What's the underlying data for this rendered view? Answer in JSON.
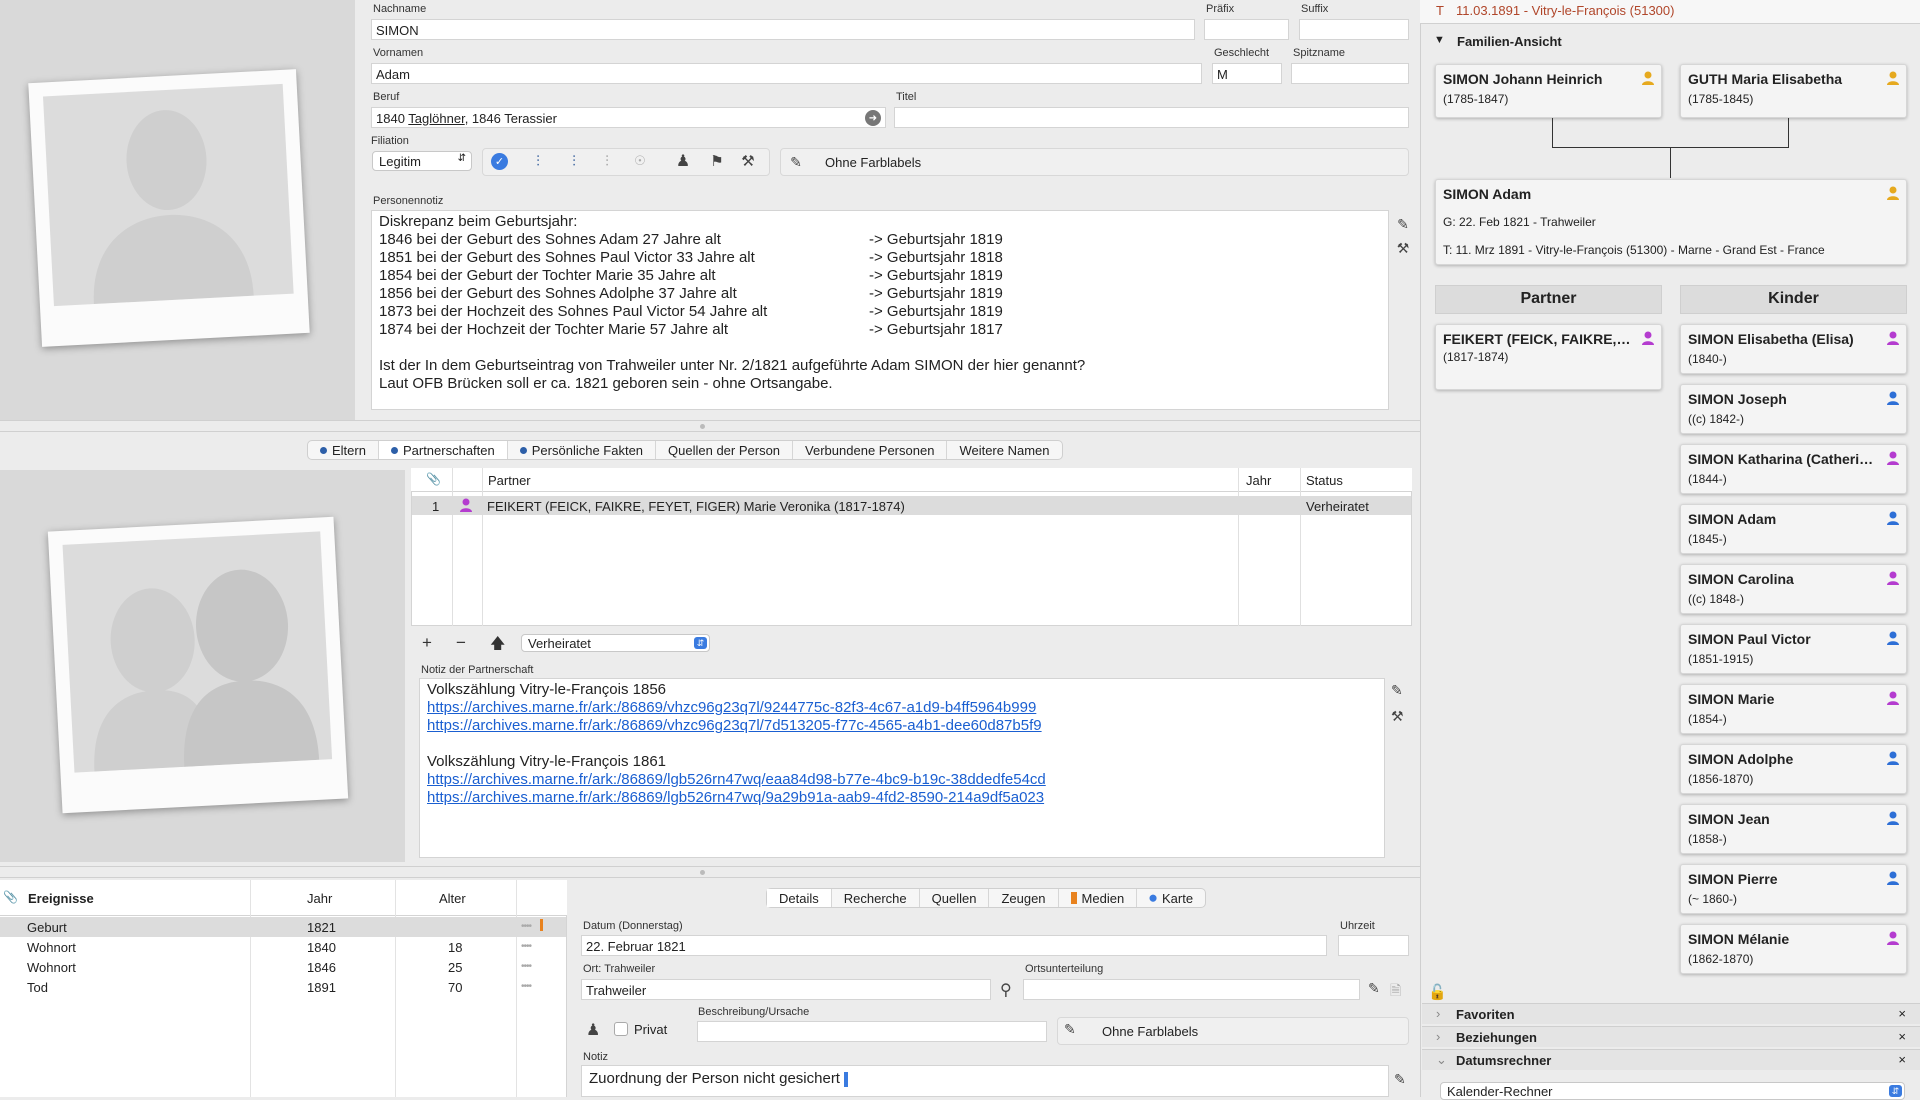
{
  "person": {
    "labels": {
      "nachname": "Nachname",
      "praefix": "Präfix",
      "suffix": "Suffix",
      "vornamen": "Vornamen",
      "geschlecht": "Geschlecht",
      "spitzname": "Spitzname",
      "beruf": "Beruf",
      "titel": "Titel",
      "filiation": "Filiation",
      "personennotiz": "Personennotiz"
    },
    "nachname": "SIMON",
    "praefix": "",
    "suffix": "",
    "vornamen": "Adam",
    "geschlecht": "M",
    "spitzname": "",
    "beruf_pre": "1840 ",
    "beruf_link": "Taglöhner",
    "beruf_post": ", 1846 Terassier",
    "titel": "",
    "filiation": "Legitim",
    "farblabel": "Ohne Farblabels",
    "note": [
      "Diskrepanz beim Geburtsjahr:",
      "1846 bei der Geburt des Sohnes Adam 27 Jahre alt",
      "1851 bei der Geburt des Sohnes Paul Victor 33 Jahre alt",
      "1854 bei der Geburt der Tochter Marie 35 Jahre alt",
      "1856 bei der Geburt des Sohnes Adolphe 37 Jahre alt",
      "1873 bei der Hochzeit des Sohnes Paul Victor 54 Jahre alt",
      "1874 bei der Hochzeit der Tochter Marie 57 Jahre alt",
      "",
      "Ist der In dem Geburtseintrag von Trahweiler unter Nr. 2/1821 aufgeführte Adam SIMON der hier genannt?",
      "Laut OFB Brücken soll er ca. 1821 geboren sein - ohne Ortsangabe."
    ],
    "note_right": [
      "",
      "-> Geburtsjahr 1819",
      "-> Geburtsjahr 1818",
      "-> Geburtsjahr 1819",
      "-> Geburtsjahr 1819",
      "-> Geburtsjahr 1819",
      "-> Geburtsjahr 1817",
      "",
      "",
      ""
    ]
  },
  "tabs": [
    {
      "label": "Eltern",
      "dot": true
    },
    {
      "label": "Partnerschaften",
      "dot": true,
      "selected": true
    },
    {
      "label": "Persönliche Fakten",
      "dot": true
    },
    {
      "label": "Quellen der Person",
      "dot": false
    },
    {
      "label": "Verbundene Personen",
      "dot": false
    },
    {
      "label": "Weitere Namen",
      "dot": false
    }
  ],
  "partners": {
    "headers": {
      "partner": "Partner",
      "jahr": "Jahr",
      "status": "Status"
    },
    "rows": [
      {
        "num": "1",
        "name": "FEIKERT (FEICK, FAIKRE, FEYET, FIGER) Marie Veronika (1817-1874)",
        "jahr": "",
        "status": "Verheiratet"
      }
    ],
    "status_select": "Verheiratet",
    "note_label": "Notiz der Partnerschaft",
    "note": [
      {
        "text": "Volkszählung Vitry-le-François 1856",
        "link": false
      },
      {
        "text": "https://archives.marne.fr/ark:/86869/vhzc96g23q7l/9244775c-82f3-4c67-a1d9-b4ff5964b999",
        "link": true
      },
      {
        "text": "https://archives.marne.fr/ark:/86869/vhzc96g23q7l/7d513205-f77c-4565-a4b1-dee60d87b5f9",
        "link": true
      },
      {
        "text": "",
        "link": false
      },
      {
        "text": "Volkszählung Vitry-le-François 1861",
        "link": false
      },
      {
        "text": "https://archives.marne.fr/ark:/86869/lgb526rn47wq/eaa84d98-b77e-4bc9-b19c-38ddedfe54cd",
        "link": true
      },
      {
        "text": "https://archives.marne.fr/ark:/86869/lgb526rn47wq/9a29b91a-aab9-4fd2-8590-214a9df5a023",
        "link": true
      }
    ]
  },
  "events": {
    "headers": {
      "ereignisse": "Ereignisse",
      "jahr": "Jahr",
      "alter": "Alter"
    },
    "rows": [
      {
        "name": "Geburt",
        "jahr": "1821",
        "alter": "",
        "selected": true
      },
      {
        "name": "Wohnort",
        "jahr": "1840",
        "alter": "18"
      },
      {
        "name": "Wohnort",
        "jahr": "1846",
        "alter": "25"
      },
      {
        "name": "Tod",
        "jahr": "1891",
        "alter": "70"
      }
    ]
  },
  "details": {
    "tabs": [
      "Details",
      "Recherche",
      "Quellen",
      "Zeugen",
      "Medien",
      "Karte"
    ],
    "datum_label": "Datum (Donnerstag)",
    "datum": "22. Februar 1821",
    "uhrzeit_label": "Uhrzeit",
    "uhrzeit": "",
    "ort_label": "Ort: Trahweiler",
    "ort": "Trahweiler",
    "ortsunterteilung_label": "Ortsunterteilung",
    "ortsunterteilung": "",
    "privat_label": "Privat",
    "beschreibung_label": "Beschreibung/Ursache",
    "beschreibung": "",
    "farblabel": "Ohne Farblabels",
    "notiz_label": "Notiz",
    "notiz": "Zuordnung der Person nicht gesichert "
  },
  "family": {
    "top_line_prefix": "T",
    "top_line": "11.03.1891 - Vitry-le-François (51300)",
    "header": "Familien-Ansicht",
    "father": {
      "name": "SIMON Johann Heinrich",
      "dates": "(1785-1847)"
    },
    "mother": {
      "name": "GUTH Maria Elisabetha",
      "dates": "(1785-1845)"
    },
    "self": {
      "name": "SIMON Adam",
      "birth": "G: 22. Feb 1821 - Trahweiler",
      "death": "T: 11. Mrz 1891 - Vitry-le-François (51300) - Marne - Grand Est - France"
    },
    "partner_header": "Partner",
    "kinder_header": "Kinder",
    "partner": {
      "name": "FEIKERT (FEICK, FAIKRE, FEYET, FIGER) Marie Veronika",
      "dates": "(1817-1874)"
    },
    "children": [
      {
        "name": "SIMON Elisabetha (Elisa)",
        "dates": "(1840-)",
        "sex": "f"
      },
      {
        "name": "SIMON Joseph",
        "dates": "((c) 1842-)",
        "sex": "m"
      },
      {
        "name": "SIMON Katharina (Catherine)",
        "dates": "(1844-)",
        "sex": "f"
      },
      {
        "name": "SIMON Adam",
        "dates": "(1845-)",
        "sex": "m"
      },
      {
        "name": "SIMON Carolina",
        "dates": "((c) 1848-)",
        "sex": "f"
      },
      {
        "name": "SIMON Paul Victor",
        "dates": "(1851-1915)",
        "sex": "m"
      },
      {
        "name": "SIMON Marie",
        "dates": "(1854-)",
        "sex": "f"
      },
      {
        "name": "SIMON Adolphe",
        "dates": "(1856-1870)",
        "sex": "m"
      },
      {
        "name": "SIMON Jean",
        "dates": "(1858-)",
        "sex": "m"
      },
      {
        "name": "SIMON Pierre",
        "dates": "(~ 1860-)",
        "sex": "m"
      },
      {
        "name": "SIMON Mélanie",
        "dates": "(1862-1870)",
        "sex": "f"
      }
    ],
    "panels": [
      "Favoriten",
      "Beziehungen",
      "Datumsrechner"
    ],
    "calendar_select": "Kalender-Rechner"
  },
  "colors": {
    "male": "#2d6fd6",
    "female": "#b43ccf",
    "unknown": "#e6a91e",
    "link": "#1a5fd1",
    "death": "#b0462a"
  }
}
